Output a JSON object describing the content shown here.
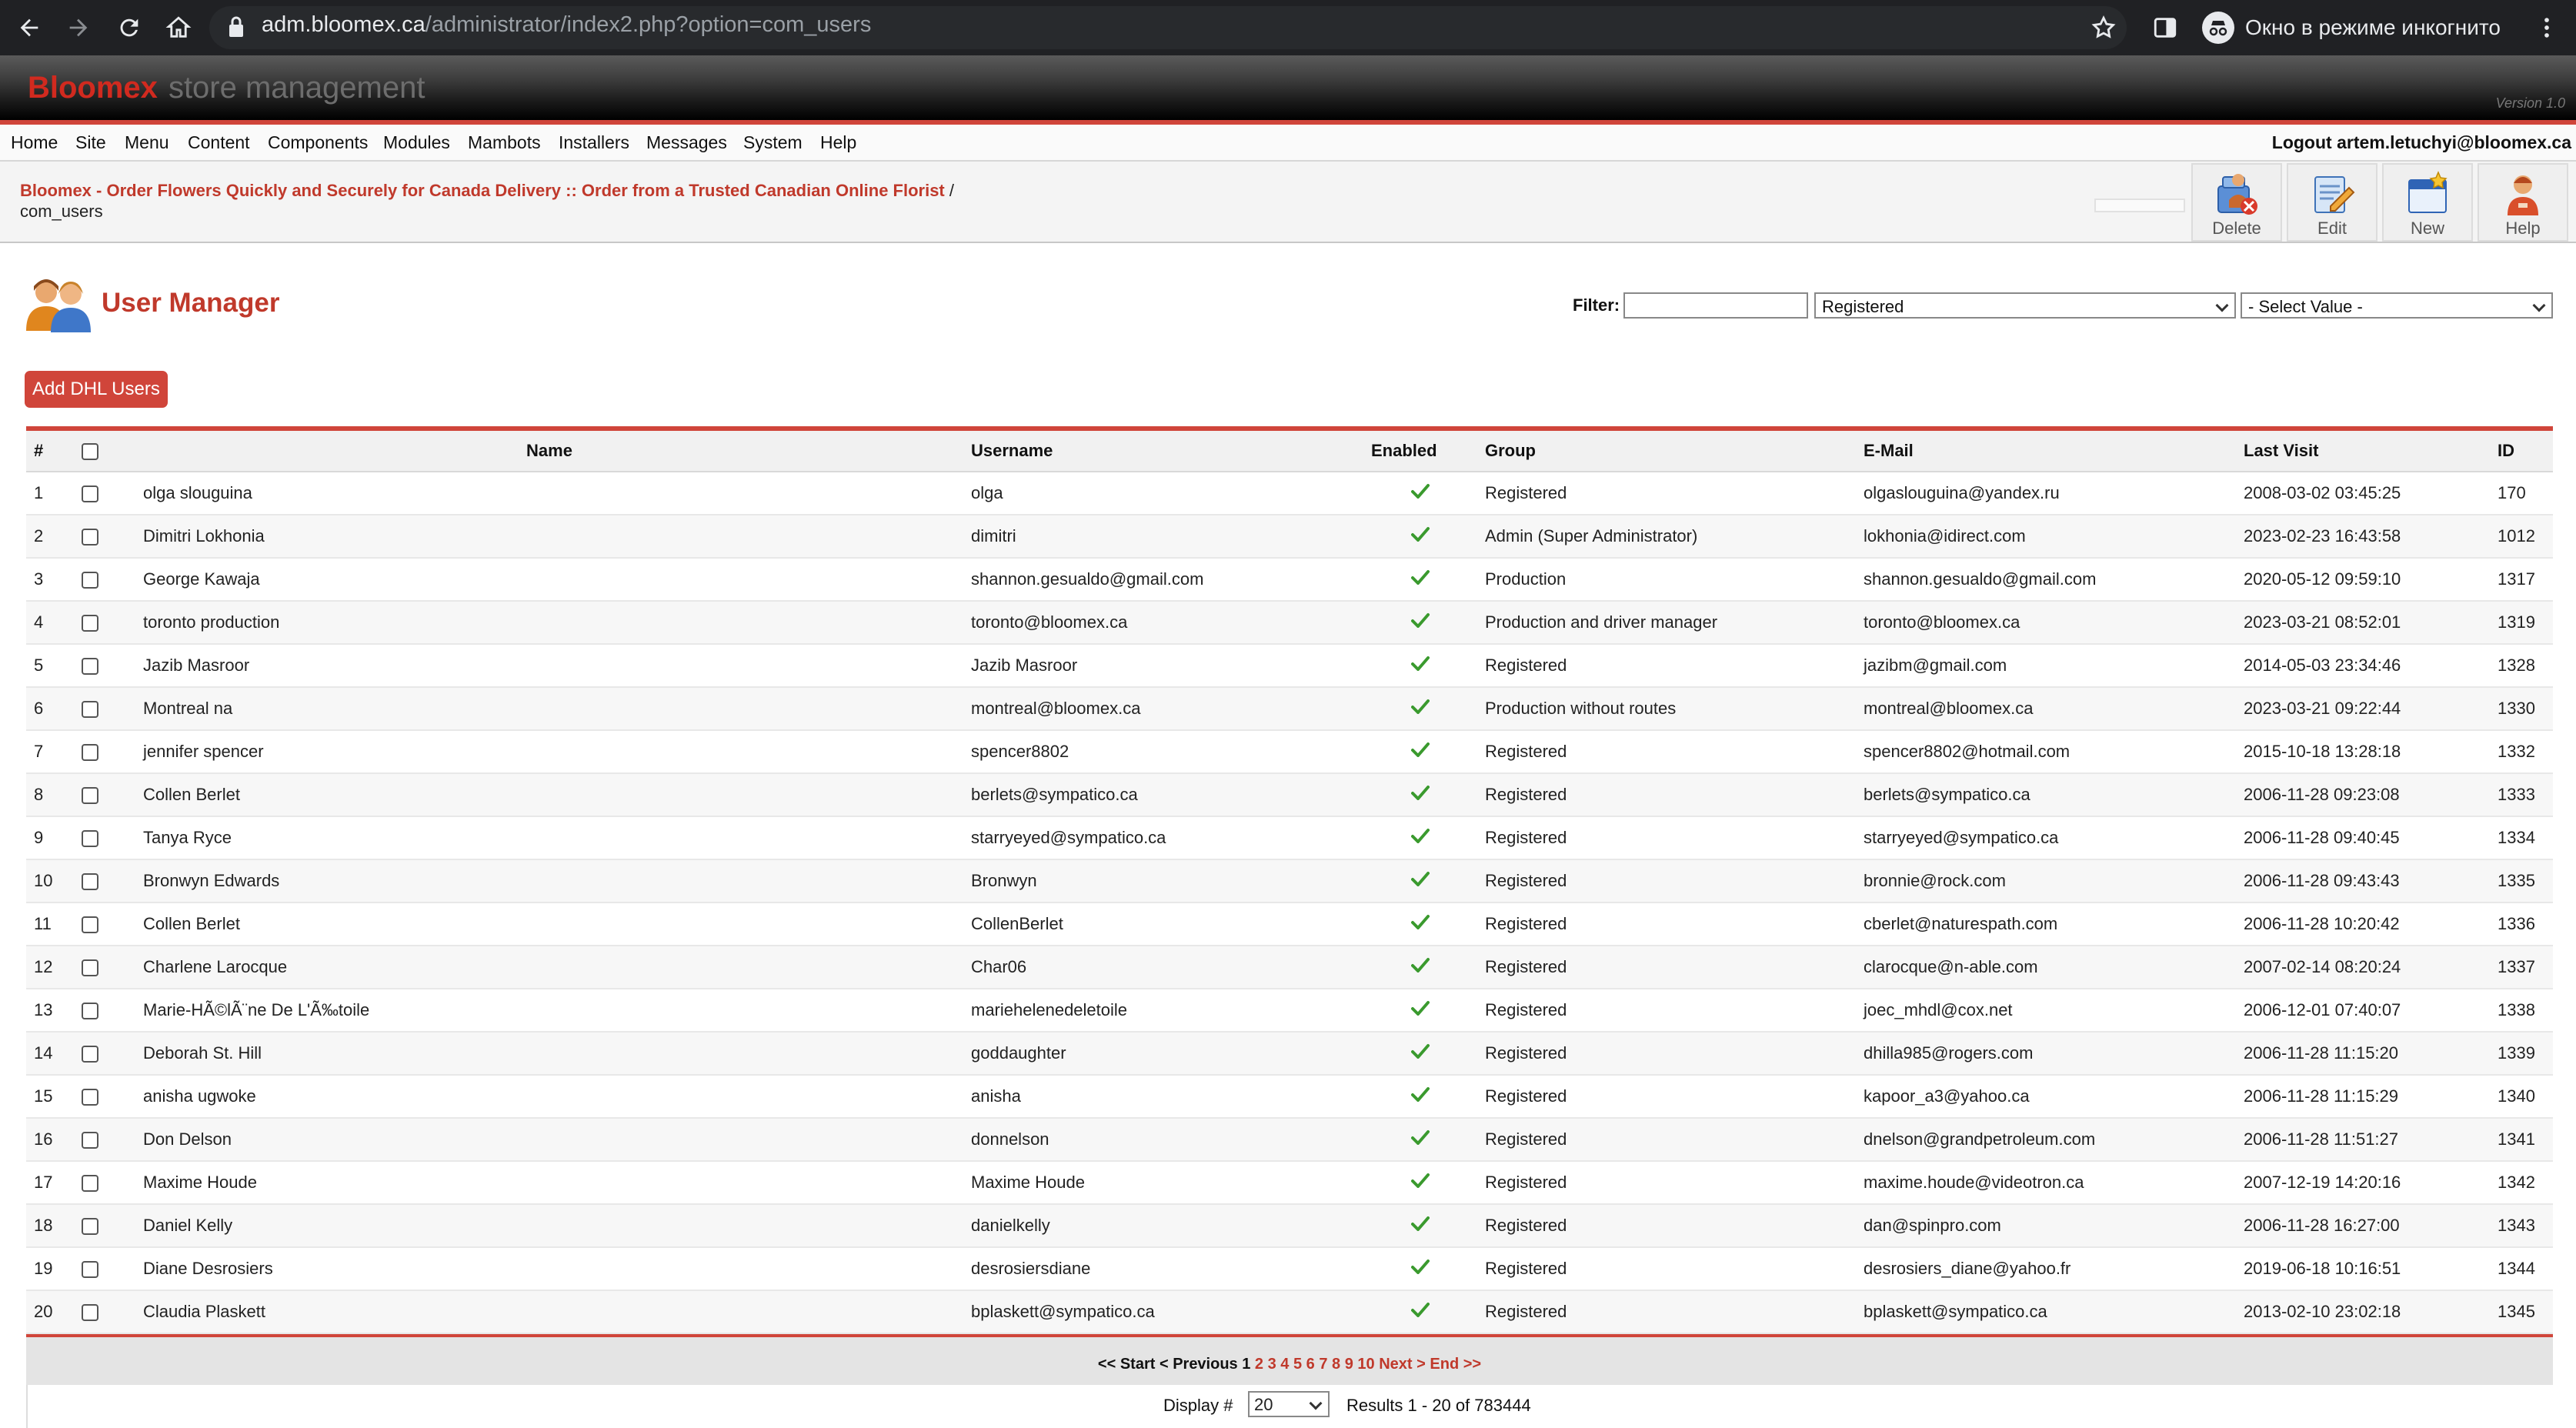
{
  "browser": {
    "url_host": "adm.bloomex.ca",
    "url_path": "/administrator/index2.php?option=com_users",
    "incognito_label": "Окно в режиме инкогнито"
  },
  "header": {
    "brand": "Bloomex",
    "subtitle": "store management",
    "version": "Version 1.0"
  },
  "menu": {
    "items": [
      "Home",
      "Site",
      "Menu",
      "Content",
      "Components",
      "Modules",
      "Mambots",
      "Installers",
      "Messages",
      "System",
      "Help"
    ],
    "logout": "Logout artem.letuchyi@bloomex.ca"
  },
  "pathway": {
    "site_link": "Bloomex - Order Flowers Quickly and Securely for Canada Delivery :: Order from a Trusted Canadian Online Florist",
    "separator": " /",
    "current": "com_users"
  },
  "toolbar": {
    "delete": "Delete",
    "edit": "Edit",
    "new": "New",
    "help": "Help"
  },
  "page": {
    "title": "User Manager",
    "filter_label": "Filter:",
    "filter_value": "",
    "group_select": "Registered",
    "value_select": "- Select Value -",
    "add_dhl": "Add DHL Users"
  },
  "table": {
    "headers": {
      "num": "#",
      "name": "Name",
      "username": "Username",
      "enabled": "Enabled",
      "group": "Group",
      "email": "E-Mail",
      "last_visit": "Last Visit",
      "id": "ID"
    },
    "rows": [
      {
        "num": "1",
        "name": "olga slouguina",
        "username": "olga",
        "group": "Registered",
        "email": "olgaslouguina@yandex.ru",
        "last_visit": "2008-03-02 03:45:25",
        "id": "170"
      },
      {
        "num": "2",
        "name": "Dimitri Lokhonia",
        "username": "dimitri",
        "group": "Admin (Super Administrator)",
        "email": "lokhonia@idirect.com",
        "last_visit": "2023-02-23 16:43:58",
        "id": "1012"
      },
      {
        "num": "3",
        "name": "George Kawaja",
        "username": "shannon.gesualdo@gmail.com",
        "group": "Production",
        "email": "shannon.gesualdo@gmail.com",
        "last_visit": "2020-05-12 09:59:10",
        "id": "1317"
      },
      {
        "num": "4",
        "name": "toronto production",
        "username": "toronto@bloomex.ca",
        "group": "Production and driver manager",
        "email": "toronto@bloomex.ca",
        "last_visit": "2023-03-21 08:52:01",
        "id": "1319"
      },
      {
        "num": "5",
        "name": "Jazib Masroor",
        "username": "Jazib Masroor",
        "group": "Registered",
        "email": "jazibm@gmail.com",
        "last_visit": "2014-05-03 23:34:46",
        "id": "1328"
      },
      {
        "num": "6",
        "name": "Montreal na",
        "username": "montreal@bloomex.ca",
        "group": "Production without routes",
        "email": "montreal@bloomex.ca",
        "last_visit": "2023-03-21 09:22:44",
        "id": "1330"
      },
      {
        "num": "7",
        "name": "jennifer spencer",
        "username": "spencer8802",
        "group": "Registered",
        "email": "spencer8802@hotmail.com",
        "last_visit": "2015-10-18 13:28:18",
        "id": "1332"
      },
      {
        "num": "8",
        "name": "Collen Berlet",
        "username": "berlets@sympatico.ca",
        "group": "Registered",
        "email": "berlets@sympatico.ca",
        "last_visit": "2006-11-28 09:23:08",
        "id": "1333"
      },
      {
        "num": "9",
        "name": "Tanya Ryce",
        "username": "starryeyed@sympatico.ca",
        "group": "Registered",
        "email": "starryeyed@sympatico.ca",
        "last_visit": "2006-11-28 09:40:45",
        "id": "1334"
      },
      {
        "num": "10",
        "name": "Bronwyn Edwards",
        "username": "Bronwyn",
        "group": "Registered",
        "email": "bronnie@rock.com",
        "last_visit": "2006-11-28 09:43:43",
        "id": "1335"
      },
      {
        "num": "11",
        "name": "Collen Berlet",
        "username": "CollenBerlet",
        "group": "Registered",
        "email": "cberlet@naturespath.com",
        "last_visit": "2006-11-28 10:20:42",
        "id": "1336"
      },
      {
        "num": "12",
        "name": "Charlene Larocque",
        "username": "Char06",
        "group": "Registered",
        "email": "clarocque@n-able.com",
        "last_visit": "2007-02-14 08:20:24",
        "id": "1337"
      },
      {
        "num": "13",
        "name": "Marie-HÃ©lÃ¨ne De L'Ã‰toile",
        "username": "mariehelenedeletoile",
        "group": "Registered",
        "email": "joec_mhdl@cox.net",
        "last_visit": "2006-12-01 07:40:07",
        "id": "1338"
      },
      {
        "num": "14",
        "name": "Deborah St. Hill",
        "username": "goddaughter",
        "group": "Registered",
        "email": "dhilla985@rogers.com",
        "last_visit": "2006-11-28 11:15:20",
        "id": "1339"
      },
      {
        "num": "15",
        "name": "anisha ugwoke",
        "username": "anisha",
        "group": "Registered",
        "email": "kapoor_a3@yahoo.ca",
        "last_visit": "2006-11-28 11:15:29",
        "id": "1340"
      },
      {
        "num": "16",
        "name": "Don Delson",
        "username": "donnelson",
        "group": "Registered",
        "email": "dnelson@grandpetroleum.com",
        "last_visit": "2006-11-28 11:51:27",
        "id": "1341"
      },
      {
        "num": "17",
        "name": "Maxime Houde",
        "username": "Maxime Houde",
        "group": "Registered",
        "email": "maxime.houde@videotron.ca",
        "last_visit": "2007-12-19 14:20:16",
        "id": "1342"
      },
      {
        "num": "18",
        "name": "Daniel Kelly",
        "username": "danielkelly",
        "group": "Registered",
        "email": "dan@spinpro.com",
        "last_visit": "2006-11-28 16:27:00",
        "id": "1343"
      },
      {
        "num": "19",
        "name": "Diane Desrosiers",
        "username": "desrosiersdiane",
        "group": "Registered",
        "email": "desrosiers_diane@yahoo.fr",
        "last_visit": "2019-06-18 10:16:51",
        "id": "1344"
      },
      {
        "num": "20",
        "name": "Claudia Plaskett",
        "username": "bplaskett@sympatico.ca",
        "group": "Registered",
        "email": "bplaskett@sympatico.ca",
        "last_visit": "2013-02-10 23:02:18",
        "id": "1345"
      }
    ]
  },
  "pager": {
    "start": "<< Start",
    "previous": "< Previous",
    "current": "1",
    "pages": [
      "2",
      "3",
      "4",
      "5",
      "6",
      "7",
      "8",
      "9",
      "10"
    ],
    "next": "Next >",
    "end": "End >>",
    "display_label": "Display #",
    "display_value": "20",
    "results": "Results 1 - 20 of 783444"
  },
  "colors": {
    "accent": "#c0392b",
    "brand_red": "#d12a1f",
    "check": "#3a9a2e",
    "rule": "#d0453a"
  }
}
